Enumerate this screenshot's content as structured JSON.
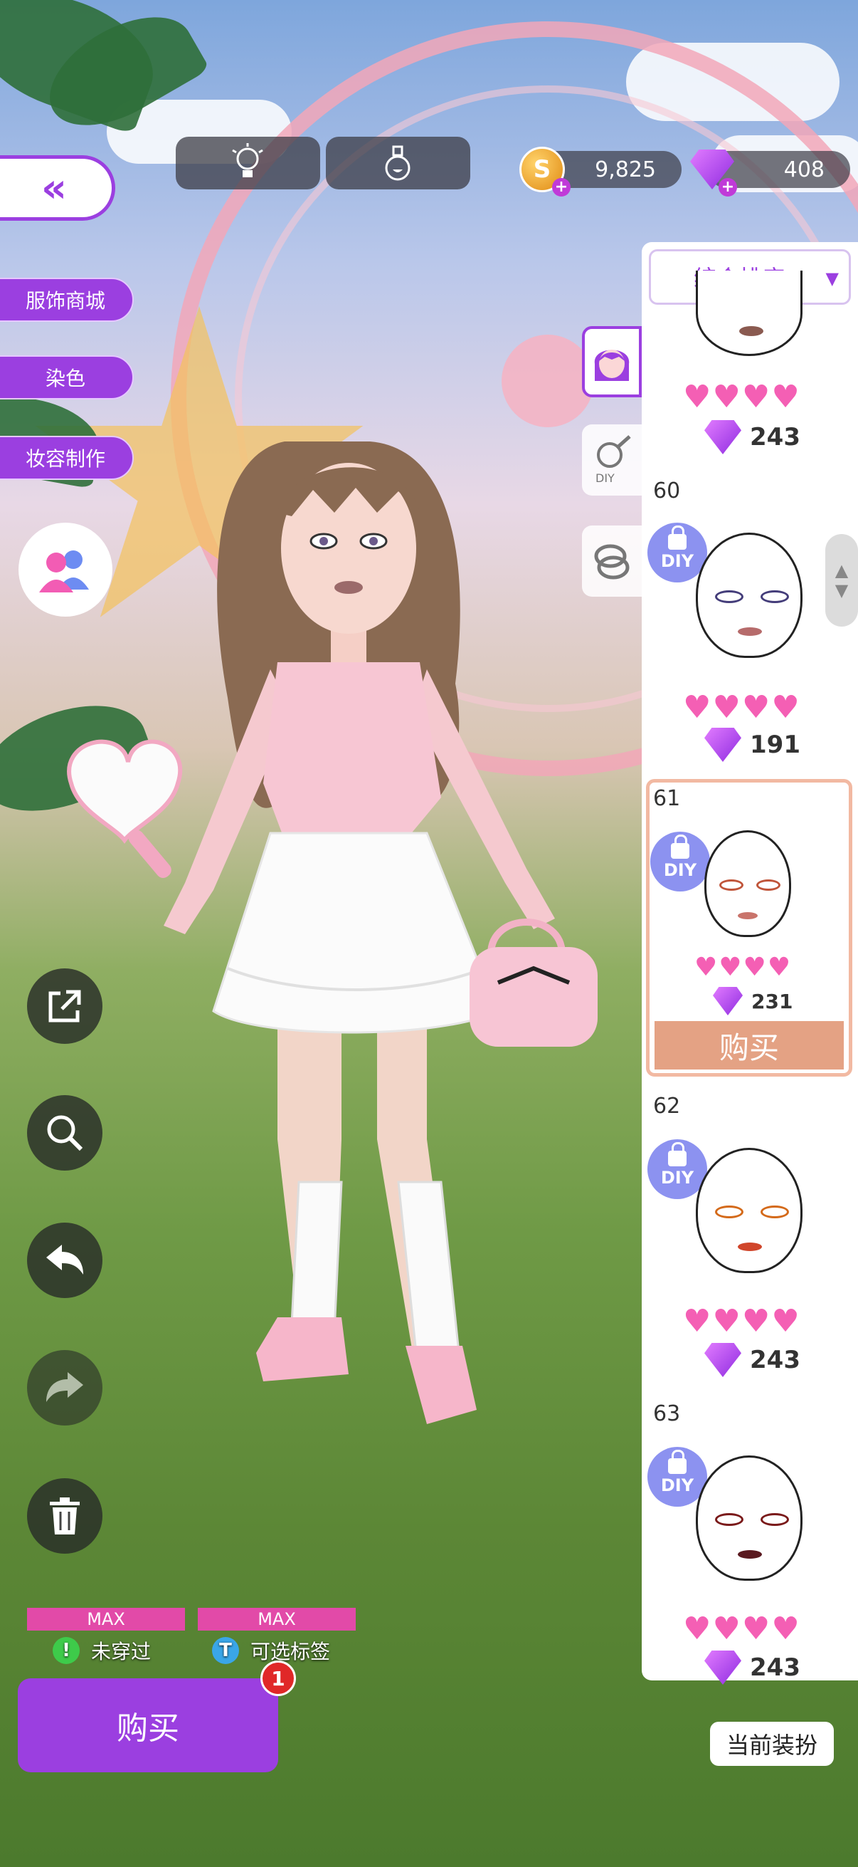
{
  "top_bar": {
    "hint_icon": "lightbulb-icon",
    "potion_icon": "potion-icon",
    "coins": "9,825",
    "gems": "408"
  },
  "left_menu": {
    "back_icon": "double-chevron-left-icon",
    "shop_label": "服饰商城",
    "dye_label": "染色",
    "makeup_label": "妆容制作",
    "tool_icons": [
      "share-icon",
      "zoom-icon",
      "undo-icon",
      "redo-icon",
      "trash-icon"
    ]
  },
  "bottom": {
    "max_left": "MAX",
    "max_right": "MAX",
    "not_worn_label": "未穿过",
    "selectable_tag_label": "可选标签",
    "buy_label": "购买",
    "badge_count": "1",
    "current_outfit_label": "当前装扮"
  },
  "panel": {
    "sort_label": "综合排序",
    "tabs": [
      "face-icon",
      "diy-makeup-icon",
      "ring-icon"
    ],
    "items": [
      {
        "num": "",
        "price": "243"
      },
      {
        "num": "60",
        "price": "191"
      },
      {
        "num": "61",
        "price": "231",
        "buy_label": "购买"
      },
      {
        "num": "62",
        "price": "243"
      },
      {
        "num": "63",
        "price": "243"
      }
    ],
    "diy_label": "DIY"
  },
  "colors": {
    "accent": "#9b3fe0",
    "heart": "#f45fb4",
    "max_bar": "#e24aa8",
    "card_buy": "#e4a284"
  }
}
